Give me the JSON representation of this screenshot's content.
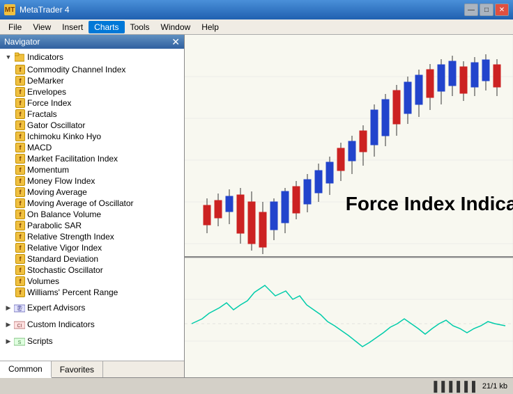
{
  "app": {
    "title": "MetaTrader 4",
    "icon_label": "MT"
  },
  "title_controls": {
    "minimize": "—",
    "maximize": "□",
    "close": "✕"
  },
  "menu": {
    "items": [
      "File",
      "View",
      "Insert",
      "Charts",
      "Tools",
      "Window",
      "Help"
    ],
    "active_index": 3
  },
  "navigator": {
    "title": "Navigator",
    "close_icon": "✕",
    "sections": {
      "indicators": {
        "label": "Indicators",
        "items": [
          "Commodity Channel Index",
          "DeMarker",
          "Envelopes",
          "Force Index",
          "Fractals",
          "Gator Oscillator",
          "Ichimoku Kinko Hyo",
          "MACD",
          "Market Facilitation Index",
          "Momentum",
          "Money Flow Index",
          "Moving Average",
          "Moving Average of Oscillator",
          "On Balance Volume",
          "Parabolic SAR",
          "Relative Strength Index",
          "Relative Vigor Index",
          "Standard Deviation",
          "Stochastic Oscillator",
          "Volumes",
          "Williams' Percent Range"
        ]
      },
      "expert_advisors": "Expert Advisors",
      "custom_indicators": "Custom Indicators",
      "scripts": "Scripts"
    }
  },
  "tabs": {
    "common": "Common",
    "favorites": "Favorites"
  },
  "chart": {
    "label": "Force Index Indicator"
  },
  "status": {
    "indicator": "21/1 kb"
  }
}
